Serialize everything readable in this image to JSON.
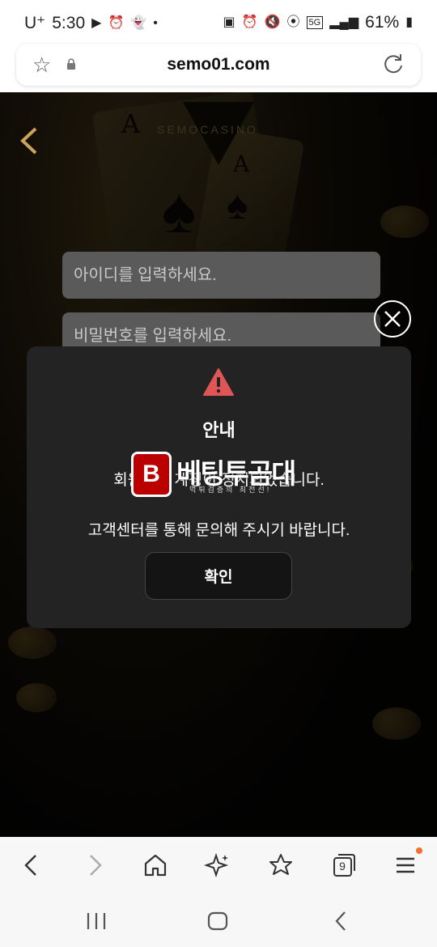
{
  "status_bar": {
    "carrier": "U⁺",
    "time": "5:30",
    "network": "5G",
    "battery": "61%"
  },
  "browser": {
    "url": "semo01.com",
    "tabs_count": "9"
  },
  "page": {
    "brand": "SEMOCASINO",
    "id_placeholder": "아이디를 입력하세요.",
    "pw_placeholder": "비밀번호를 입력하세요."
  },
  "modal": {
    "title": "안내",
    "message_line1": "회원님의 계정이 정지되었습니다.",
    "message_line2": "고객센터를 통해 문의해 주시기 바랍니다.",
    "confirm_label": "확인"
  },
  "watermark": {
    "badge": "B",
    "text": "베팅투곰대",
    "sub": "먹튀검증의 최전선!"
  },
  "colors": {
    "warning": "#e05555",
    "modal_bg": "#232323",
    "menu_dot": "#f36f2b"
  }
}
